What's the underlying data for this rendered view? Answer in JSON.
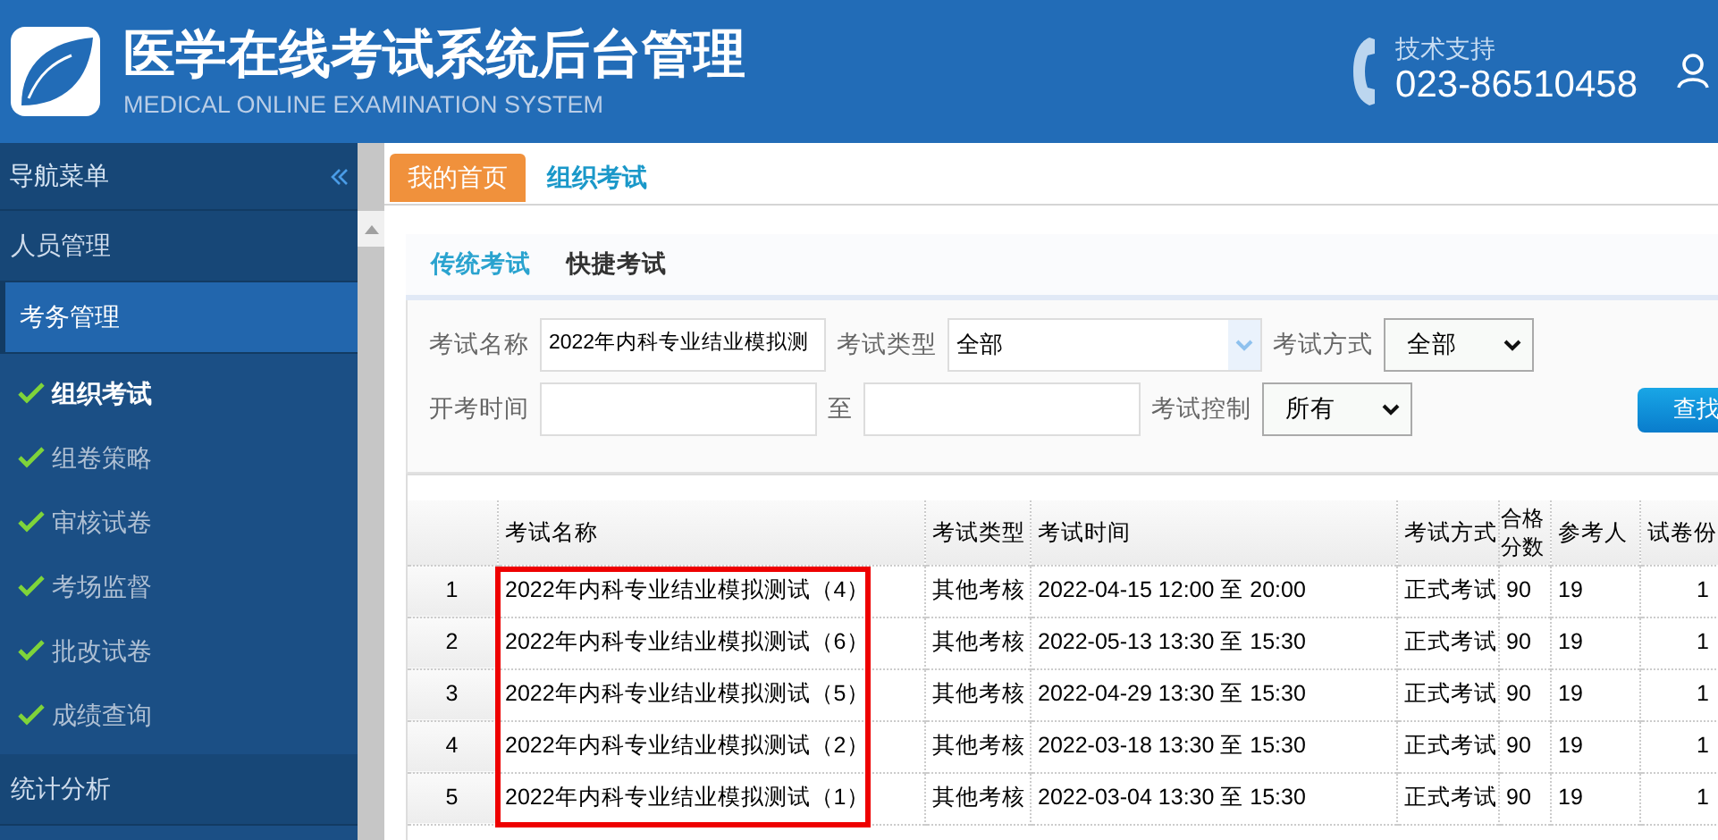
{
  "header": {
    "title": "医学在线考试系统后台管理",
    "subtitle": "MEDICAL ONLINE EXAMINATION SYSTEM",
    "support_label": "技术支持",
    "support_phone": "023-86510458"
  },
  "sidebar": {
    "title": "导航菜单",
    "items": [
      {
        "label": "人员管理",
        "expanded": false,
        "selected": false
      },
      {
        "label": "考务管理",
        "expanded": true,
        "selected": true,
        "children": [
          {
            "label": "组织考试",
            "selected": true
          },
          {
            "label": "组卷策略",
            "selected": false
          },
          {
            "label": "审核试卷",
            "selected": false
          },
          {
            "label": "考场监督",
            "selected": false
          },
          {
            "label": "批改试卷",
            "selected": false
          },
          {
            "label": "成绩查询",
            "selected": false
          }
        ]
      },
      {
        "label": "统计分析",
        "expanded": false,
        "selected": false
      }
    ]
  },
  "page_tabs": [
    {
      "label": "我的首页",
      "selected": true
    },
    {
      "label": "组织考试",
      "selected": false
    }
  ],
  "exam_tabs": [
    {
      "label": "传统考试",
      "selected": true
    },
    {
      "label": "快捷考试",
      "selected": false
    }
  ],
  "filters": {
    "name_label": "考试名称",
    "name_value": "2022年内科专业结业模拟测",
    "type_label": "考试类型",
    "type_value": "全部",
    "mode_label": "考试方式",
    "mode_value": "全部",
    "start_label": "开考时间",
    "to_label": "至",
    "control_label": "考试控制",
    "control_value": "所有",
    "search_button": "查找"
  },
  "table": {
    "columns": [
      "考试名称",
      "考试类型",
      "考试时间",
      "考试方式",
      "合格分数",
      "参考人",
      "试卷份"
    ],
    "name_highlight": true,
    "rows": [
      {
        "index": "1",
        "cells": [
          "2022年内科专业结业模拟测试（4）",
          "其他考核",
          "2022-04-15 12:00 至 20:00",
          "正式考试",
          "90",
          "19",
          "1"
        ]
      },
      {
        "index": "2",
        "cells": [
          "2022年内科专业结业模拟测试（6）",
          "其他考核",
          "2022-05-13 13:30 至 15:30",
          "正式考试",
          "90",
          "19",
          "1"
        ]
      },
      {
        "index": "3",
        "cells": [
          "2022年内科专业结业模拟测试（5）",
          "其他考核",
          "2022-04-29 13:30 至 15:30",
          "正式考试",
          "90",
          "19",
          "1"
        ]
      },
      {
        "index": "4",
        "cells": [
          "2022年内科专业结业模拟测试（2）",
          "其他考核",
          "2022-03-18 13:30 至 15:30",
          "正式考试",
          "90",
          "19",
          "1"
        ]
      },
      {
        "index": "5",
        "cells": [
          "2022年内科专业结业模拟测试（1）",
          "其他考核",
          "2022-03-04 13:30 至 15:30",
          "正式考试",
          "90",
          "19",
          "1"
        ]
      }
    ]
  }
}
